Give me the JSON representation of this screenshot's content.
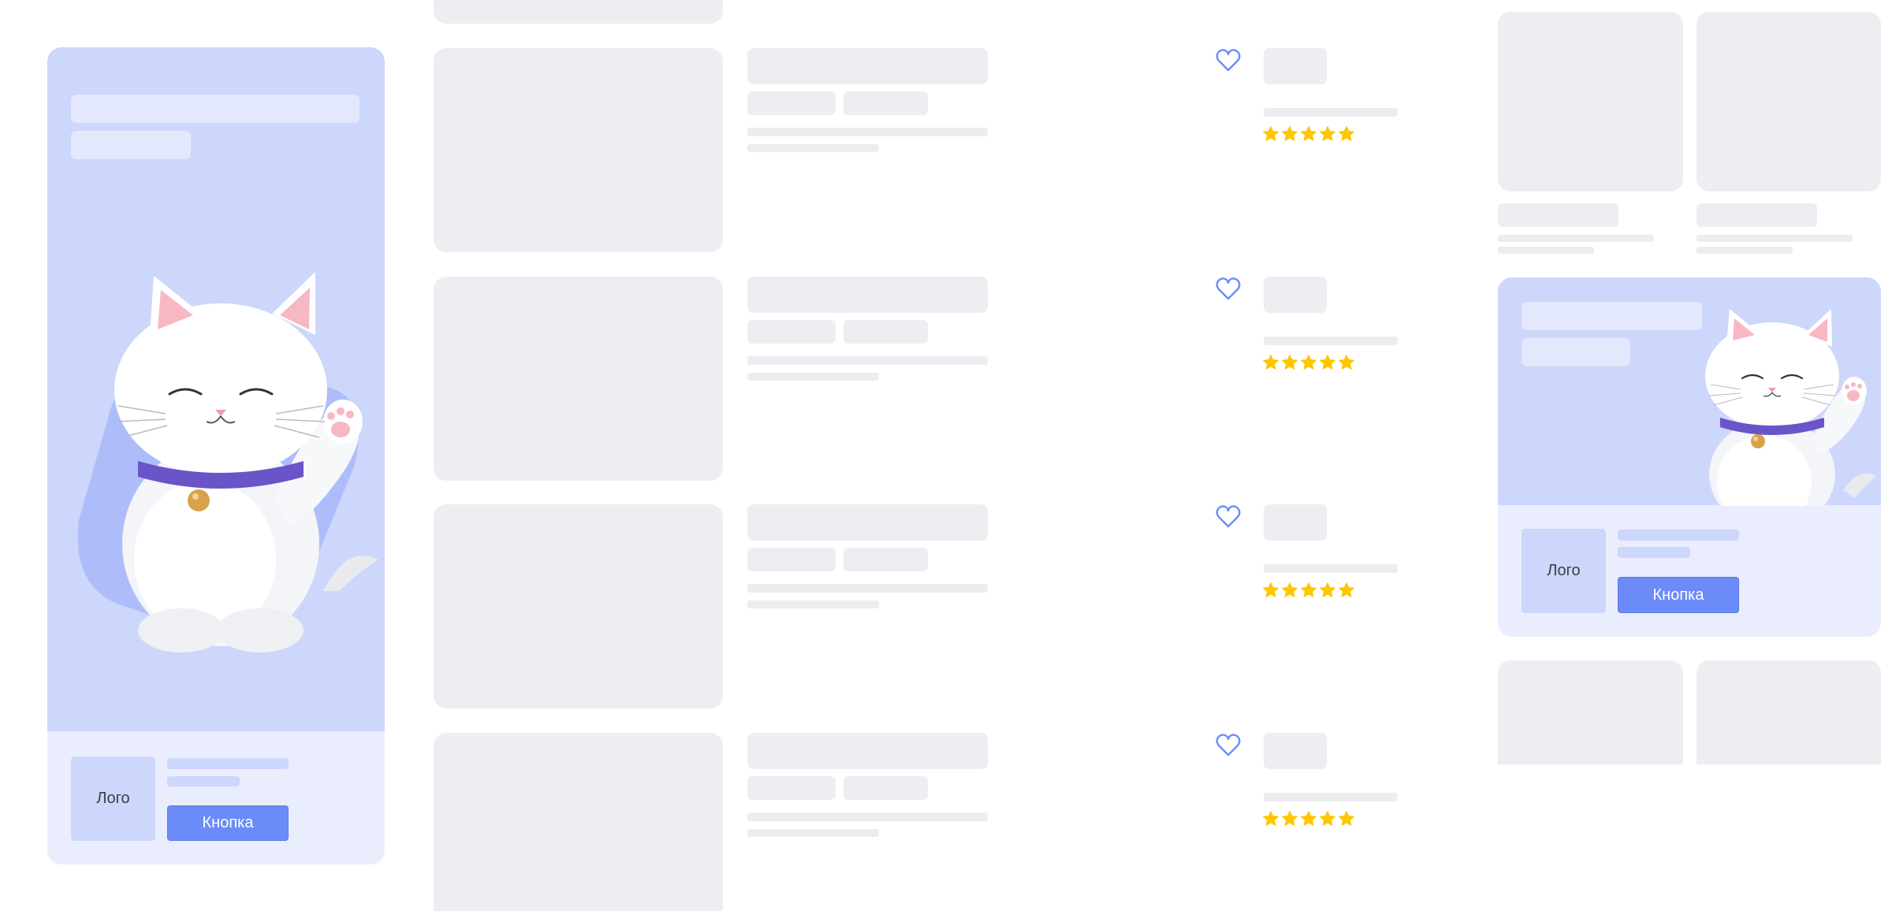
{
  "banner_left": {
    "logo_label": "Лого",
    "button_label": "Кнопка"
  },
  "banner_right": {
    "logo_label": "Лого",
    "button_label": "Кнопка"
  },
  "product_rows": [
    {
      "favorite": false,
      "rating": 5
    },
    {
      "favorite": false,
      "rating": 5
    },
    {
      "favorite": false,
      "rating": 5
    },
    {
      "favorite": false,
      "rating": 5
    }
  ],
  "colors": {
    "accent": "#6b8cf8",
    "banner_bg": "#cdd6fb",
    "banner_footer_bg": "#eaedfd",
    "skeleton": "#edeef2",
    "star": "#ffc700",
    "heart_outline": "#6b8cf8"
  },
  "icons": {
    "favorite": "heart-outline-icon",
    "rating": "star-icon"
  }
}
